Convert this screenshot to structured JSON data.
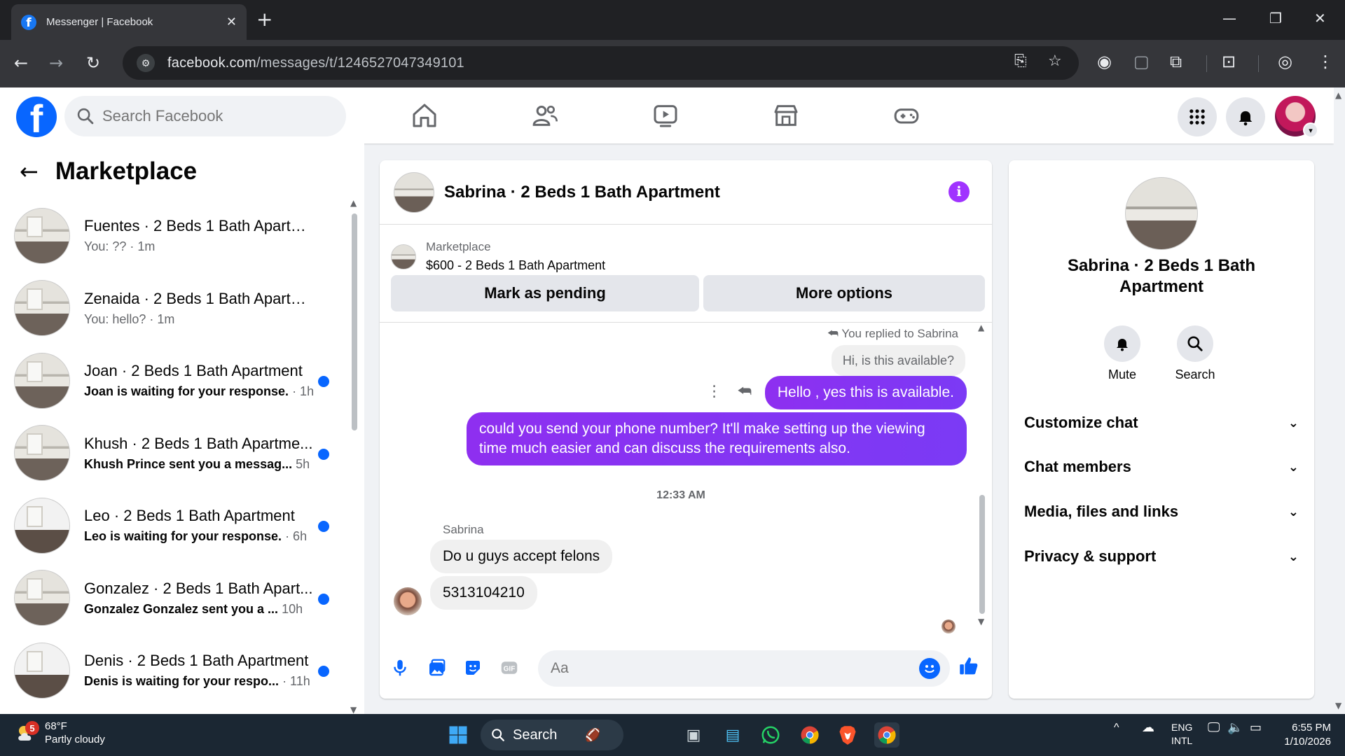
{
  "browser": {
    "tab_title": "Messenger | Facebook",
    "url_host": "facebook.com",
    "url_path": "/messages/t/1246527047349101"
  },
  "fb_header": {
    "search_placeholder": "Search Facebook",
    "nav": [
      "home-icon",
      "friends-icon",
      "video-icon",
      "marketplace-icon",
      "gaming-icon"
    ]
  },
  "marketplace": {
    "title": "Marketplace",
    "conversations": [
      {
        "name": "Fuentes · 2 Beds 1 Bath Apartment",
        "snippet": "You: ?? · 1m",
        "time": "",
        "unread": false
      },
      {
        "name": "Zenaida · 2 Beds 1 Bath Apartme...",
        "snippet": "You: hello? · 1m",
        "time": "",
        "unread": false
      },
      {
        "name": "Joan · 2 Beds 1 Bath Apartment",
        "snippet": "Joan is waiting for your response.",
        "time": " · 1h",
        "unread": true
      },
      {
        "name": "Khush · 2 Beds 1 Bath Apartme...",
        "snippet": "Khush Prince sent you a messag...",
        "time": " 5h",
        "unread": true
      },
      {
        "name": "Leo · 2 Beds 1 Bath Apartment",
        "snippet": "Leo is waiting for your response.",
        "time": " · 6h",
        "unread": true
      },
      {
        "name": "Gonzalez · 2 Beds 1 Bath Apart...",
        "snippet": "Gonzalez Gonzalez sent you a ...",
        "time": " 10h",
        "unread": true
      },
      {
        "name": "Denis · 2 Beds 1 Bath Apartment",
        "snippet": "Denis is waiting for your respo...",
        "time": " · 11h",
        "unread": true
      }
    ]
  },
  "chat": {
    "title": "Sabrina · 2 Beds 1 Bath Apartment",
    "listing_category": "Marketplace",
    "listing_item": "$600 - 2 Beds 1 Bath Apartment",
    "mark_pending": "Mark as pending",
    "more_options": "More options",
    "replied_note": "You replied to Sabrina",
    "quoted_message": "Hi, is this available?",
    "my_reply": "Hello , yes this is available.",
    "my_message": "could you send your phone number? It'll make setting up the viewing time much easier and can discuss the requirements also.",
    "timestamp": "12:33 AM",
    "sender_name": "Sabrina",
    "their_message_1": "Do u guys accept felons",
    "their_message_2": "5313104210",
    "input_placeholder": "Aa"
  },
  "info_panel": {
    "name": "Sabrina · 2 Beds 1 Bath Apartment",
    "mute": "Mute",
    "search": "Search",
    "rows": [
      "Customize chat",
      "Chat members",
      "Media, files and links",
      "Privacy & support"
    ]
  },
  "taskbar": {
    "temp": "68°F",
    "weather": "Partly cloudy",
    "weather_badge": "5",
    "search": "Search",
    "lang1": "ENG",
    "lang2": "INTL",
    "time": "6:55 PM",
    "date": "1/10/2026"
  },
  "colors": {
    "fb_blue": "#0866ff",
    "my_bubble": "#8e2ff0",
    "info_icon": "#a033ff"
  }
}
